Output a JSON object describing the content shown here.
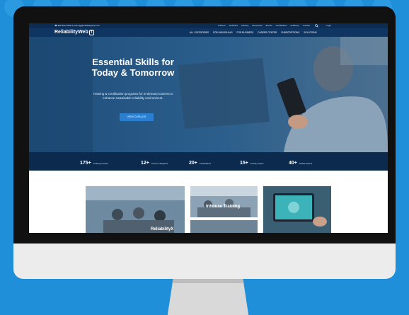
{
  "topbar": {
    "phone": "☎ 800-200-1555",
    "email": "✉ training@reliabilityweb.com",
    "links": [
      "Careers",
      "Webinars",
      "Industry",
      "Resources",
      "Events",
      "Certification",
      "Academy",
      "Contact"
    ],
    "login_label": "Login"
  },
  "nav": {
    "logo_text": "ReliabilityWeb",
    "logo_badge": "T",
    "links": [
      "ALL CATEGORIES",
      "FOR INDIVIDUALS",
      "FOR BUSINESS",
      "CAREER CENTER",
      "SUBSCRIPTIONS",
      "SOLUTIONS"
    ]
  },
  "hero": {
    "title": "Essential Skills for Today & Tomorrow",
    "subtitle": "Training & Certification programs for in-demand careers to enhance sustainable reliability environment.",
    "button_label": "VIEW CATALOG"
  },
  "stats": [
    {
      "num": "175+",
      "label": "Training Courses"
    },
    {
      "num": "12+",
      "label": "Course Categories"
    },
    {
      "num": "20+",
      "label": "Certifications"
    },
    {
      "num": "15+",
      "label": "Industry Topics"
    },
    {
      "num": "40+",
      "label": "Global Experts"
    }
  ],
  "cards": [
    {
      "label": "ReliabilityX"
    },
    {
      "label": "Inhouse Training"
    },
    {
      "label": ""
    },
    {
      "label": ""
    }
  ],
  "colors": {
    "background": "#1e8fd8",
    "navy": "#0f3563",
    "stats_bar": "#0b2a4d",
    "accent": "#2a7fd0"
  }
}
